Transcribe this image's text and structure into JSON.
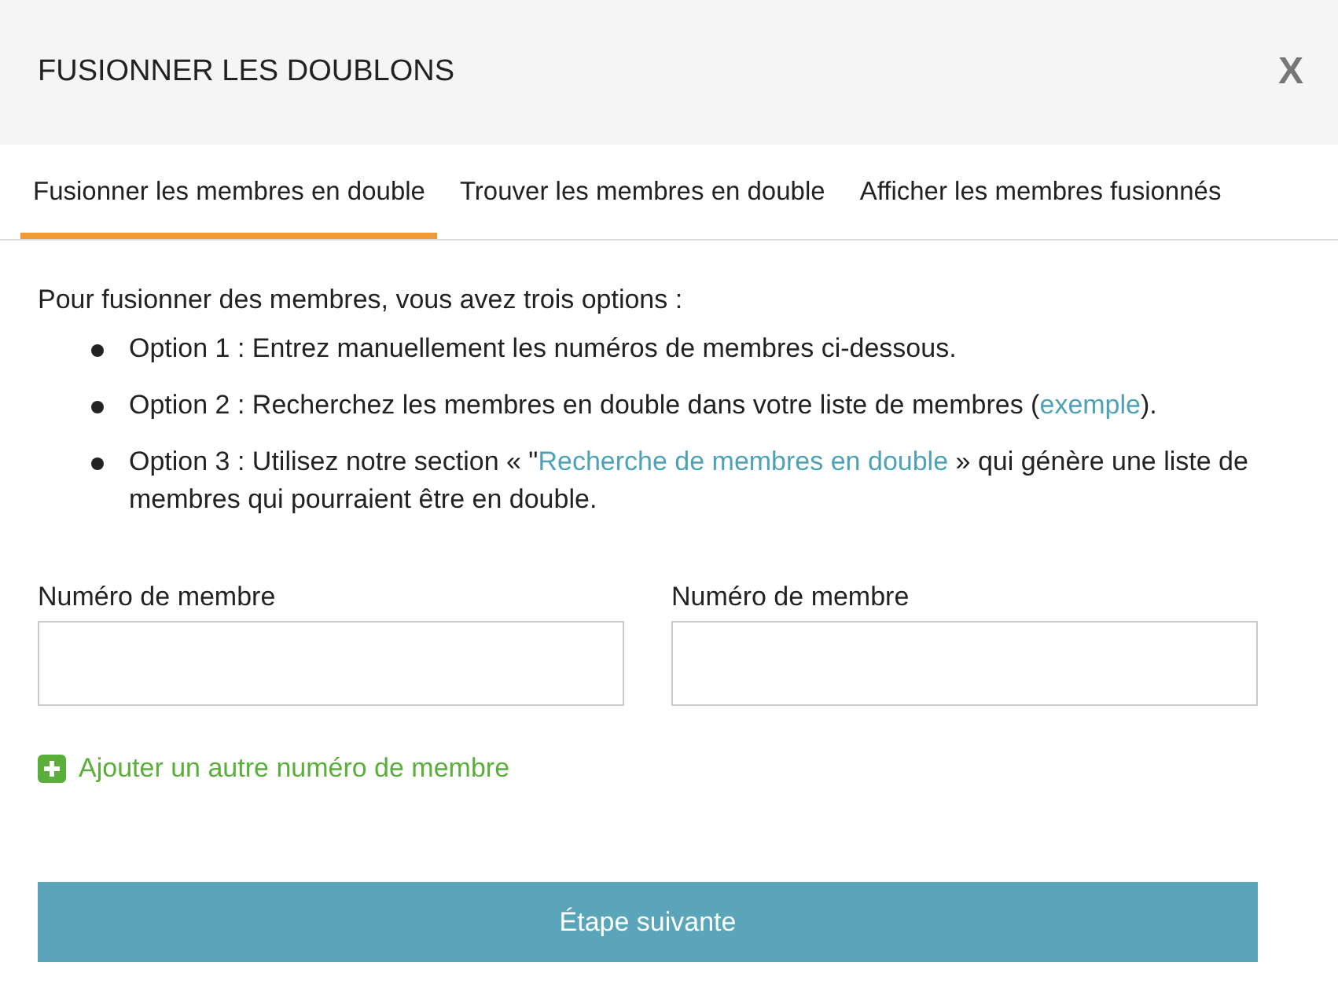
{
  "dialog": {
    "title": "FUSIONNER LES DOUBLONS",
    "close": "X"
  },
  "tabs": [
    {
      "label": "Fusionner les membres en double",
      "selected": true
    },
    {
      "label": "Trouver les membres en double",
      "selected": false
    },
    {
      "label": "Afficher les membres fusionnés",
      "selected": false
    }
  ],
  "intro": "Pour fusionner des membres, vous avez trois options :",
  "options": [
    {
      "parts": [
        {
          "kind": "text",
          "text": "Option 1 : Entrez manuellement les numéros de membres ci-dessous."
        }
      ]
    },
    {
      "parts": [
        {
          "kind": "text",
          "text": "Option 2 : Recherchez les membres en double dans votre liste de membres ("
        },
        {
          "kind": "link",
          "text": "exemple"
        },
        {
          "kind": "text",
          "text": ")."
        }
      ]
    },
    {
      "parts": [
        {
          "kind": "text",
          "text": "Option 3 : Utilisez notre section « \""
        },
        {
          "kind": "link",
          "text": "Recherche de membres en double"
        },
        {
          "kind": "text",
          "text": " » qui génère une liste de membres qui pourraient être en double."
        }
      ]
    }
  ],
  "fields": [
    {
      "label": "Numéro de membre"
    },
    {
      "label": "Numéro de membre"
    }
  ],
  "add_link": "Ajouter un autre numéro de membre",
  "next_button": "Étape suivante"
}
